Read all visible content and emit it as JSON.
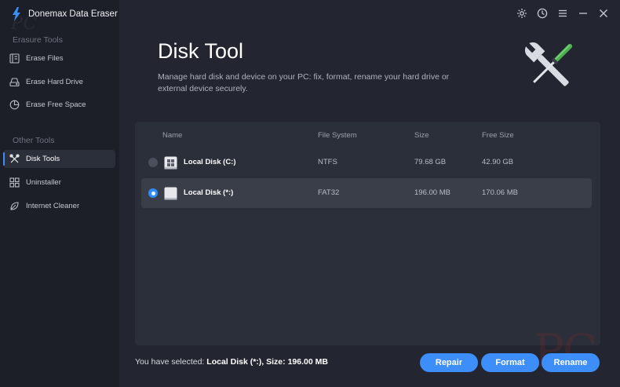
{
  "app": {
    "title": "Donemax Data Eraser",
    "watermark": "PC"
  },
  "sidebar": {
    "section_erasure": "Erasure Tools",
    "section_other": "Other Tools",
    "items": [
      {
        "label": "Erase Files",
        "icon": "erase-files-icon"
      },
      {
        "label": "Erase Hard Drive",
        "icon": "hard-drive-icon"
      },
      {
        "label": "Erase Free Space",
        "icon": "free-space-icon"
      },
      {
        "label": "Disk Tools",
        "icon": "disk-tools-icon",
        "active": true
      },
      {
        "label": "Uninstaller",
        "icon": "uninstaller-icon"
      },
      {
        "label": "Internet Cleaner",
        "icon": "internet-cleaner-icon"
      }
    ]
  },
  "header": {
    "title": "Disk Tool",
    "description": "Manage hard disk and device on your PC: fix, format, rename your hard drive or external device securely."
  },
  "table": {
    "columns": [
      "Name",
      "File System",
      "Size",
      "Free Size"
    ],
    "rows": [
      {
        "name": "Local Disk (C:)",
        "fs": "NTFS",
        "size": "79.68 GB",
        "free": "42.90 GB",
        "selected": false
      },
      {
        "name": "Local Disk (*:)",
        "fs": "FAT32",
        "size": "196.00 MB",
        "free": "170.06 MB",
        "selected": true
      }
    ]
  },
  "footer": {
    "selected_prefix": "You have selected:",
    "selected_name": "Local Disk (*:),",
    "size_label": "Size:",
    "size_value": "196.00 MB",
    "buttons": {
      "repair": "Repair",
      "format": "Format",
      "rename": "Rename"
    }
  },
  "colors": {
    "accent": "#3d8ef8",
    "background": "#232630",
    "sidebar": "#1c1f27",
    "panel": "#2b2f3a"
  }
}
